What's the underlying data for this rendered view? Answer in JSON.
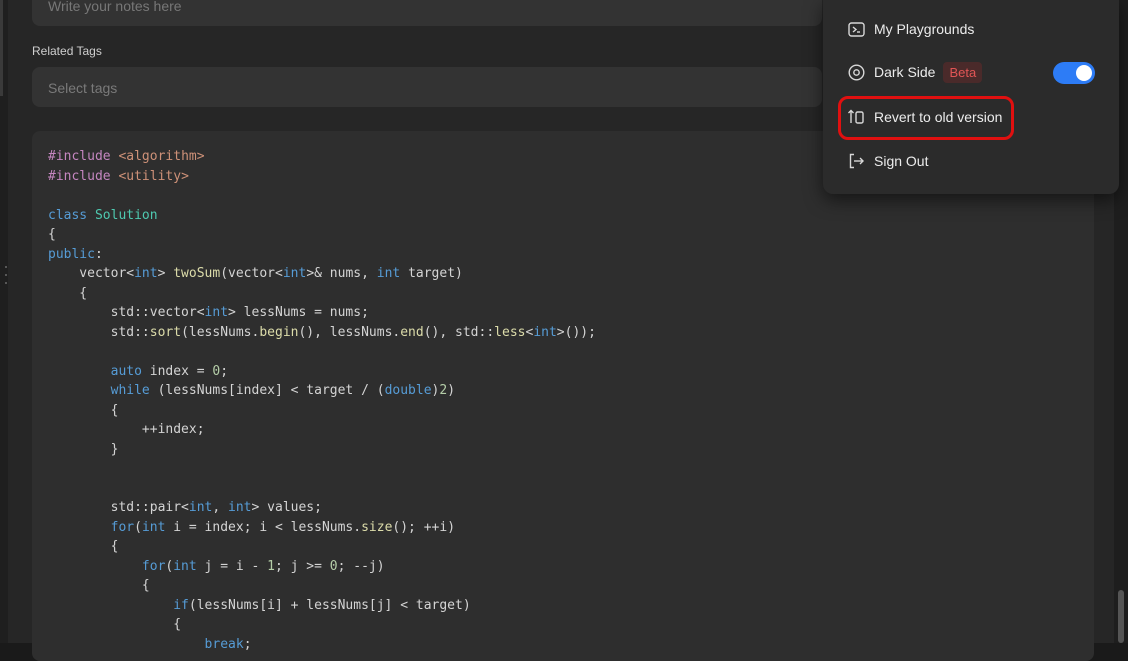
{
  "notes": {
    "placeholder": "Write your notes here"
  },
  "tags": {
    "label": "Related Tags",
    "placeholder": "Select tags"
  },
  "menu": {
    "playgrounds_label": "My Playgrounds",
    "dark_side_label": "Dark Side",
    "beta_badge": "Beta",
    "dark_side_enabled": true,
    "revert_label": "Revert to old version",
    "sign_out_label": "Sign Out",
    "icons": [
      "playground-icon",
      "dark-mode-icon",
      "revert-icon",
      "sign-out-icon"
    ]
  },
  "colors": {
    "toggle_on": "#2d7cf6",
    "beta_text": "#e05555",
    "annotation_red": "#e01010"
  },
  "code": {
    "language": "cpp",
    "lines": [
      "#include <algorithm>",
      "#include <utility>",
      "",
      "class Solution",
      "{",
      "public:",
      "    vector<int> twoSum(vector<int>& nums, int target)",
      "    {",
      "        std::vector<int> lessNums = nums;",
      "        std::sort(lessNums.begin(), lessNums.end(), std::less<int>());",
      "",
      "        auto index = 0;",
      "        while (lessNums[index] < target / (double)2)",
      "        {",
      "            ++index;",
      "        }",
      "",
      "",
      "        std::pair<int, int> values;",
      "        for(int i = index; i < lessNums.size(); ++i)",
      "        {",
      "            for(int j = i - 1; j >= 0; --j)",
      "            {",
      "                if(lessNums[i] + lessNums[j] < target)",
      "                {",
      "                    break;"
    ]
  }
}
